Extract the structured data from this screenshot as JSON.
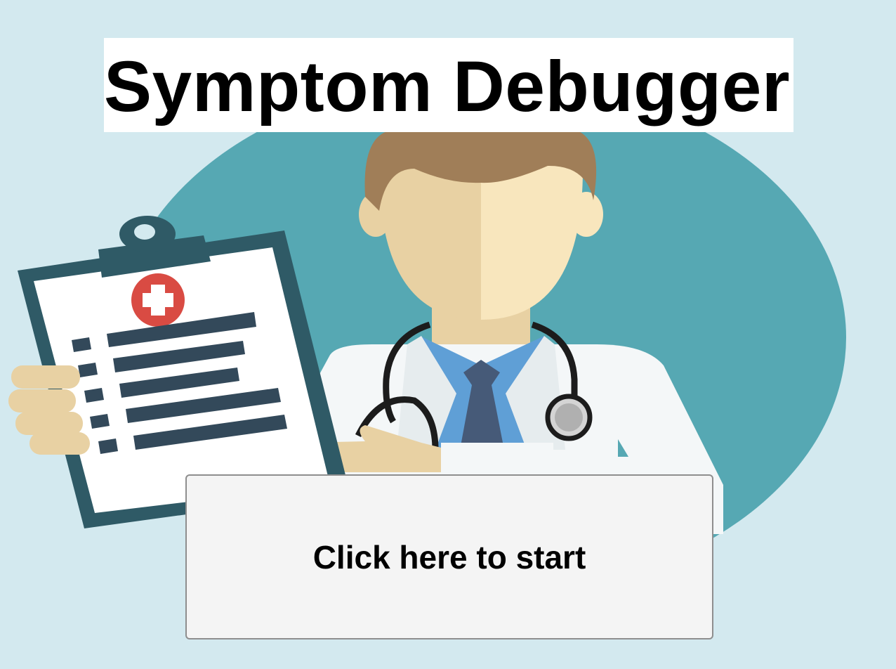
{
  "header": {
    "title": "Symptom Debugger"
  },
  "start": {
    "label": "Click here to start"
  },
  "illustration": {
    "subject": "doctor-with-clipboard",
    "icons": [
      "clipboard-icon",
      "medical-cross-icon",
      "stethoscope-icon"
    ]
  },
  "colors": {
    "background": "#d3e9ef",
    "teal_circle": "#56a8b3",
    "hair": "#a07e58",
    "skin_light": "#f8e6bd",
    "skin_dark": "#e8d1a3",
    "coat": "#f4f7f8",
    "shirt": "#5f9fd6",
    "tie": "#465a78",
    "clipboard_frame": "#2f5a66",
    "clipboard_lines": "#33495a",
    "cross_red": "#d94b43",
    "title_bg": "#ffffff",
    "button_bg": "#f4f4f4",
    "button_border": "#8e8e8e"
  }
}
